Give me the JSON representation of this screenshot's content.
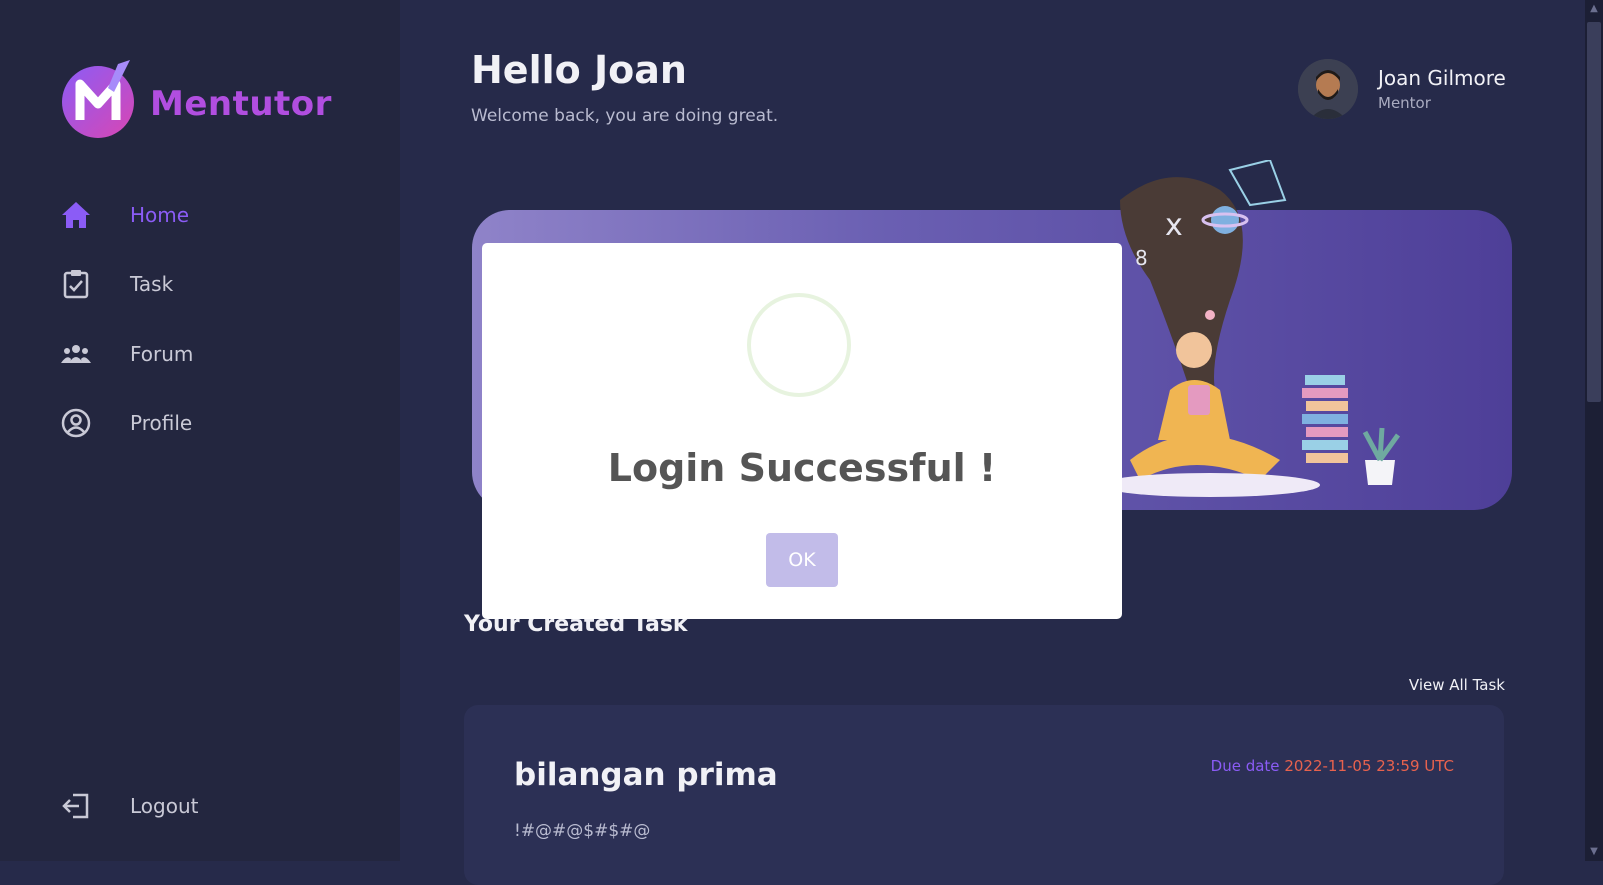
{
  "brand": {
    "name": "Mentutor"
  },
  "sidebar": {
    "items": [
      {
        "label": "Home",
        "icon": "home-icon",
        "active": true
      },
      {
        "label": "Task",
        "icon": "clipboard-check-icon"
      },
      {
        "label": "Forum",
        "icon": "users-icon"
      },
      {
        "label": "Profile",
        "icon": "user-circle-icon"
      }
    ],
    "logout_label": "Logout"
  },
  "header": {
    "greeting": "Hello Joan",
    "subtitle": "Welcome back, you are doing great."
  },
  "user": {
    "name": "Joan Gilmore",
    "role": "Mentor"
  },
  "tasks": {
    "section_title": "Your Created Task",
    "view_all_label": "View All Task",
    "items": [
      {
        "title": "bilangan prima",
        "description": "!#@#@$#$#@",
        "due_label": "Due date",
        "due_value": "2022-11-05 23:59 UTC"
      }
    ]
  },
  "modal": {
    "title": "Login Successful !",
    "ok_label": "OK"
  },
  "colors": {
    "accent": "#8b5cf6",
    "background": "#262a4a",
    "sidebar": "#23263f",
    "due_date": "#e8624e"
  }
}
